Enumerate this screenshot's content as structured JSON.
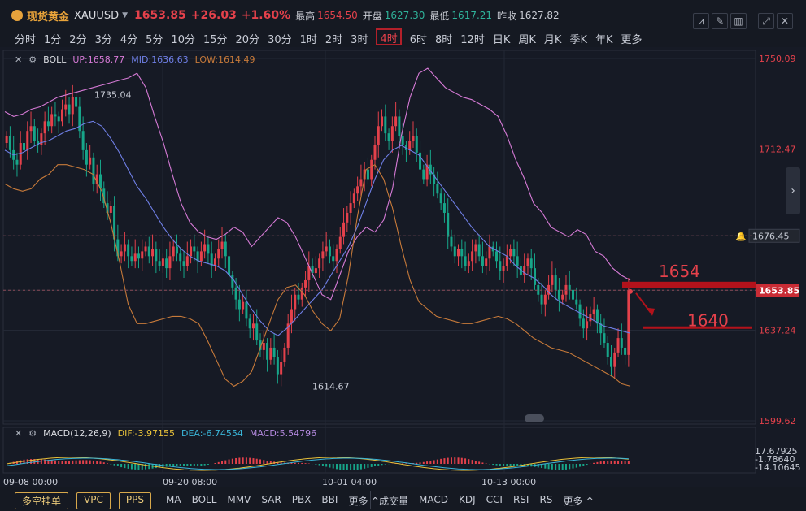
{
  "header": {
    "instrument_name": "现货黄金",
    "symbol": "XAUUSD",
    "last_price": "1653.85",
    "change": "+26.03",
    "change_pct": "+1.60%",
    "high_label": "最高",
    "high_value": "1654.50",
    "open_label": "开盘",
    "open_value": "1627.30",
    "low_label": "最低",
    "low_value": "1617.21",
    "prev_close_label": "昨收",
    "prev_close_value": "1627.82"
  },
  "periods": [
    "分时",
    "1分",
    "2分",
    "3分",
    "4分",
    "5分",
    "10分",
    "15分",
    "20分",
    "30分",
    "1时",
    "2时",
    "3时",
    "4时",
    "6时",
    "8时",
    "12时",
    "日K",
    "周K",
    "月K",
    "季K",
    "年K",
    "更多"
  ],
  "active_period": "4时",
  "boll": {
    "name": "BOLL",
    "up": "UP:1658.77",
    "mid": "MID:1636.63",
    "low": "LOW:1614.49"
  },
  "macd": {
    "name": "MACD(12,26,9)",
    "dif": "DIF:-3.97155",
    "dea": "DEA:-6.74554",
    "macd": "MACD:5.54796",
    "axis_top": "17.67925",
    "axis_mid": "-1.78640",
    "axis_bot": "-14.10645"
  },
  "toolbar": {
    "btn1": "多空挂单",
    "btn2": "VPC",
    "btn3": "PPS",
    "main_inds": [
      "MA",
      "BOLL",
      "MMV",
      "SAR",
      "PBX",
      "BBI",
      "更多 ^"
    ],
    "sub_inds": [
      "成交量",
      "MACD",
      "KDJ",
      "CCI",
      "RSI",
      "RS",
      "更多 ^"
    ]
  },
  "x_labels": [
    "09-08 00:00",
    "09-20 08:00",
    "10-01 04:00",
    "10-13 00:00"
  ],
  "colors": {
    "up": "#e4414b",
    "down": "#17a589",
    "boll_up": "#d67ad6",
    "boll_mid": "#6f7fe6",
    "boll_low": "#c77a3a",
    "annotation": "#b3121b"
  },
  "chart_data": {
    "type": "candlestick",
    "y_axis_ticks": [
      1750.09,
      1712.47,
      1676.45,
      1653.85,
      1637.24,
      1599.62
    ],
    "ylim": [
      1599.62,
      1750.09
    ],
    "current_price": 1653.85,
    "alert_price": 1676.45,
    "annotations": [
      {
        "text": "1735.04",
        "value": 1735.04
      },
      {
        "text": "1614.67",
        "value": 1614.67
      },
      {
        "text": "1654",
        "value": 1654
      },
      {
        "text": "1640",
        "value": 1640
      }
    ],
    "x_labels": [
      "09-08 00:00",
      "09-20 08:00",
      "10-01 04:00",
      "10-13 00:00"
    ],
    "close_series": [
      1718,
      1712,
      1708,
      1706,
      1715,
      1712,
      1720,
      1722,
      1716,
      1714,
      1719,
      1724,
      1722,
      1727,
      1726,
      1724,
      1729,
      1731,
      1727,
      1734,
      1730,
      1720,
      1712,
      1706,
      1709,
      1698,
      1702,
      1696,
      1690,
      1686,
      1689,
      1675,
      1668,
      1670,
      1673,
      1668,
      1666,
      1669,
      1667,
      1670,
      1672,
      1668,
      1671,
      1666,
      1664,
      1667,
      1663,
      1668,
      1672,
      1669,
      1666,
      1664,
      1668,
      1672,
      1670,
      1666,
      1670,
      1673,
      1669,
      1664,
      1667,
      1671,
      1674,
      1668,
      1660,
      1655,
      1650,
      1646,
      1649,
      1642,
      1638,
      1640,
      1633,
      1629,
      1632,
      1625,
      1630,
      1626,
      1619,
      1624,
      1630,
      1640,
      1646,
      1652,
      1650,
      1655,
      1658,
      1664,
      1661,
      1663,
      1667,
      1670,
      1672,
      1668,
      1666,
      1671,
      1676,
      1682,
      1686,
      1690,
      1694,
      1697,
      1700,
      1704,
      1700,
      1708,
      1714,
      1722,
      1726,
      1719,
      1716,
      1722,
      1726,
      1718,
      1714,
      1712,
      1716,
      1718,
      1711,
      1704,
      1700,
      1706,
      1702,
      1698,
      1694,
      1690,
      1686,
      1676,
      1672,
      1668,
      1671,
      1668,
      1664,
      1666,
      1670,
      1673,
      1668,
      1664,
      1667,
      1672,
      1670,
      1666,
      1662,
      1664,
      1668,
      1671,
      1668,
      1664,
      1660,
      1664,
      1667,
      1663,
      1656,
      1652,
      1648,
      1652,
      1656,
      1660,
      1654,
      1650,
      1652,
      1656,
      1654,
      1650,
      1648,
      1642,
      1638,
      1641,
      1644,
      1646,
      1640,
      1636,
      1632,
      1626,
      1622,
      1628,
      1634,
      1630,
      1627,
      1654
    ],
    "boll_upper": [
      1728,
      1726,
      1727,
      1729,
      1730,
      1732,
      1734,
      1735,
      1736,
      1737,
      1738,
      1739,
      1740,
      1741,
      1742,
      1744,
      1738,
      1726,
      1715,
      1702,
      1690,
      1682,
      1678,
      1676,
      1675,
      1677,
      1680,
      1678,
      1672,
      1676,
      1680,
      1684,
      1682,
      1676,
      1668,
      1660,
      1652,
      1650,
      1660,
      1670,
      1676,
      1680,
      1678,
      1683,
      1696,
      1718,
      1734,
      1744,
      1746,
      1742,
      1738,
      1736,
      1734,
      1733,
      1731,
      1729,
      1726,
      1718,
      1708,
      1700,
      1690,
      1686,
      1680,
      1678,
      1676,
      1679,
      1677,
      1670,
      1668,
      1663,
      1660,
      1658
    ],
    "boll_mid": [
      1712,
      1710,
      1711,
      1713,
      1715,
      1716,
      1718,
      1720,
      1721,
      1723,
      1724,
      1722,
      1717,
      1711,
      1704,
      1697,
      1692,
      1686,
      1680,
      1675,
      1671,
      1668,
      1666,
      1665,
      1664,
      1662,
      1658,
      1652,
      1646,
      1641,
      1637,
      1635,
      1638,
      1642,
      1646,
      1650,
      1654,
      1660,
      1666,
      1672,
      1680,
      1690,
      1700,
      1708,
      1712,
      1714,
      1712,
      1710,
      1705,
      1700,
      1695,
      1690,
      1685,
      1680,
      1676,
      1672,
      1670,
      1668,
      1664,
      1661,
      1659,
      1656,
      1652,
      1649,
      1647,
      1645,
      1643,
      1641,
      1639,
      1638,
      1637,
      1636
    ],
    "boll_lower": [
      1698,
      1696,
      1695,
      1696,
      1700,
      1702,
      1706,
      1706,
      1705,
      1704,
      1702,
      1695,
      1682,
      1666,
      1648,
      1640,
      1640,
      1641,
      1642,
      1643,
      1643,
      1642,
      1640,
      1633,
      1625,
      1617,
      1614,
      1616,
      1620,
      1630,
      1640,
      1650,
      1655,
      1656,
      1652,
      1645,
      1640,
      1637,
      1642,
      1660,
      1684,
      1704,
      1706,
      1700,
      1688,
      1672,
      1658,
      1649,
      1646,
      1643,
      1642,
      1641,
      1640,
      1640,
      1641,
      1642,
      1643,
      1642,
      1640,
      1637,
      1634,
      1632,
      1630,
      1629,
      1628,
      1626,
      1624,
      1622,
      1620,
      1618,
      1615,
      1614
    ]
  }
}
